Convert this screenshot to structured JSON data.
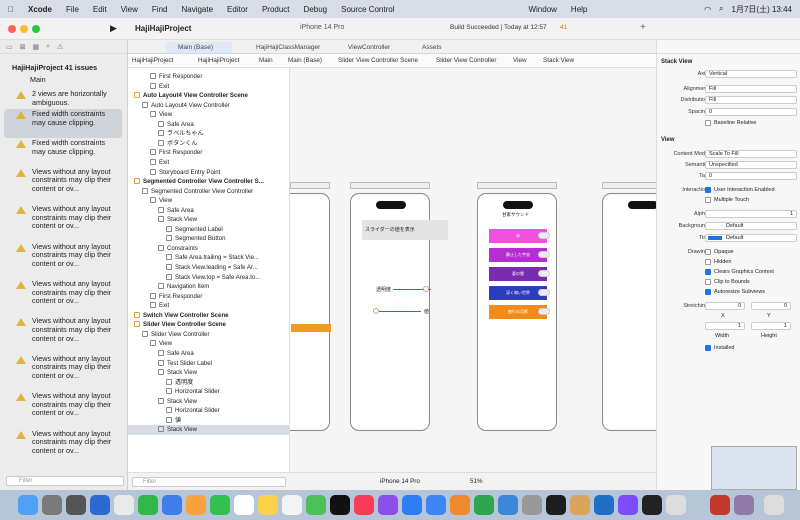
{
  "menubar": {
    "app": "Xcode",
    "items": [
      "File",
      "Edit",
      "View",
      "Find",
      "Navigate",
      "Editor",
      "Product",
      "Debug",
      "Source Control",
      "Window",
      "Help"
    ],
    "clock": "1月7日(土) 13:44"
  },
  "titlebar": {
    "project": "HajiHajiProject",
    "scheme_target": "iPhone 14 Pro",
    "build_status": "Build Succeeded | Today at 12:57",
    "warnings": "41"
  },
  "navigator": {
    "project_title": "HajiHajiProject 41 issues",
    "group": "Main",
    "issues": [
      "2 views are horizontally ambiguous.",
      "Fixed width constraints may cause clipping.",
      "Fixed width constraints may cause clipping.",
      "Views without any layout constraints may clip their content or ov...",
      "Views without any layout constraints may clip their content or ov...",
      "Views without any layout constraints may clip their content or ov...",
      "Views without any layout constraints may clip their content or ov...",
      "Views without any layout constraints may clip their content or ov...",
      "Views without any layout constraints may clip their content or ov...",
      "Views without any layout constraints may clip their content or ov...",
      "Views without any layout constraints may clip their content or ov..."
    ],
    "filter_placeholder": "Filter"
  },
  "tabs": [
    "Main (Base)",
    "HajiHajiClassManager",
    "ViewController",
    "Assets"
  ],
  "jumpbar": [
    "HajiHajiProject",
    "HajiHajiProject",
    "Main",
    "Main (Base)",
    "Slider View Controller Scene",
    "Slider View Controller",
    "View",
    "Stack View"
  ],
  "outline": [
    {
      "text": "First Responder",
      "indent": 22,
      "sec": false
    },
    {
      "text": "Exit",
      "indent": 22,
      "sec": false
    },
    {
      "text": "Auto Layout4 View Controller Scene",
      "indent": 6,
      "sec": true
    },
    {
      "text": "Auto Layout4 View Controller",
      "indent": 14,
      "sec": false
    },
    {
      "text": "View",
      "indent": 22,
      "sec": false
    },
    {
      "text": "Safe Area",
      "indent": 30,
      "sec": false
    },
    {
      "text": "ラベルちゃん",
      "indent": 30,
      "sec": false
    },
    {
      "text": "ボタンくん",
      "indent": 30,
      "sec": false
    },
    {
      "text": "First Responder",
      "indent": 22,
      "sec": false
    },
    {
      "text": "Exit",
      "indent": 22,
      "sec": false
    },
    {
      "text": "Storyboard Entry Point",
      "indent": 22,
      "sec": false
    },
    {
      "text": "Segmented Controller View Controller S...",
      "indent": 6,
      "sec": true
    },
    {
      "text": "Segmented Controller View Controller",
      "indent": 14,
      "sec": false
    },
    {
      "text": "View",
      "indent": 22,
      "sec": false
    },
    {
      "text": "Safe Area",
      "indent": 30,
      "sec": false
    },
    {
      "text": "Stack View",
      "indent": 30,
      "sec": false
    },
    {
      "text": "Segmented Label",
      "indent": 38,
      "sec": false
    },
    {
      "text": "Segmented Button",
      "indent": 38,
      "sec": false
    },
    {
      "text": "Constraints",
      "indent": 30,
      "sec": false
    },
    {
      "text": "Safe Area.trailing = Stack Vie...",
      "indent": 38,
      "sec": false
    },
    {
      "text": "Stack View.leading = Safe Ar...",
      "indent": 38,
      "sec": false
    },
    {
      "text": "Stack View.top = Safe Area.to...",
      "indent": 38,
      "sec": false
    },
    {
      "text": "Navigation Item",
      "indent": 30,
      "sec": false
    },
    {
      "text": "First Responder",
      "indent": 22,
      "sec": false
    },
    {
      "text": "Exit",
      "indent": 22,
      "sec": false
    },
    {
      "text": "Switch View Controller Scene",
      "indent": 6,
      "sec": true
    },
    {
      "text": "Slider View Controller Scene",
      "indent": 6,
      "sec": true
    },
    {
      "text": "Slider View Controller",
      "indent": 14,
      "sec": false
    },
    {
      "text": "View",
      "indent": 22,
      "sec": false
    },
    {
      "text": "Safe Area",
      "indent": 30,
      "sec": false
    },
    {
      "text": "Test Slider Label",
      "indent": 30,
      "sec": false
    },
    {
      "text": "Stack View",
      "indent": 30,
      "sec": false
    },
    {
      "text": "透明度",
      "indent": 38,
      "sec": false
    },
    {
      "text": "Horizontal Slider",
      "indent": 38,
      "sec": false
    },
    {
      "text": "Stack View",
      "indent": 30,
      "sec": false
    },
    {
      "text": "Horizontal Slider",
      "indent": 38,
      "sec": false
    },
    {
      "text": "値",
      "indent": 38,
      "sec": false
    },
    {
      "text": "Stack View",
      "indent": 30,
      "sec": false
    }
  ],
  "canvas": {
    "slider_label": "スライダーの値を表示",
    "opacity_label": "透明度",
    "value_label": "値",
    "switch_title": "甘家サウンド",
    "switch_rows": [
      {
        "label": "赤",
        "color": "#f04fe0"
      },
      {
        "label": "静止した宇宙",
        "color": "#b32fd2"
      },
      {
        "label": "夏の雲",
        "color": "#7a2ab0"
      },
      {
        "label": "深く暗い世界",
        "color": "#2c3cbf"
      },
      {
        "label": "夜行の月影",
        "color": "#f28c16"
      }
    ]
  },
  "bottombar": {
    "device": "iPhone 14 Pro",
    "zoom": "51%",
    "filter_placeholder": "Filter"
  },
  "inspector": {
    "section": "Stack View",
    "axis": "Vertical",
    "alignment": "Fill",
    "distribution": "Fill",
    "spacing": "0",
    "baseline_relative": "Baseline Relative",
    "view_section": "View",
    "content_mode": "Scale To Fill",
    "semantic": "Unspecified",
    "tag": "0",
    "interaction_user": "User Interaction Enabled",
    "interaction_multi": "Multiple Touch",
    "alpha": "1",
    "background": "Default",
    "tint": "Default",
    "drawing": [
      "Opaque",
      "Hidden",
      "Clears Graphics Context",
      "Clip to Bounds",
      "Autoresize Subviews"
    ],
    "stretching_x": "0",
    "stretching_y": "0",
    "stretching_w": "1",
    "stretching_h": "1",
    "installed": "Installed",
    "labels": {
      "axis": "Axis",
      "alignment": "Alignment",
      "distribution": "Distribution",
      "spacing": "Spacing",
      "content_mode": "Content Mode",
      "semantic": "Semantic",
      "tag": "Tag",
      "interaction": "Interaction",
      "alpha": "Alpha",
      "background": "Background",
      "tint": "Tint",
      "drawing": "Drawing",
      "stretching": "Stretching",
      "x": "X",
      "y": "Y",
      "width": "Width",
      "height": "Height"
    }
  }
}
